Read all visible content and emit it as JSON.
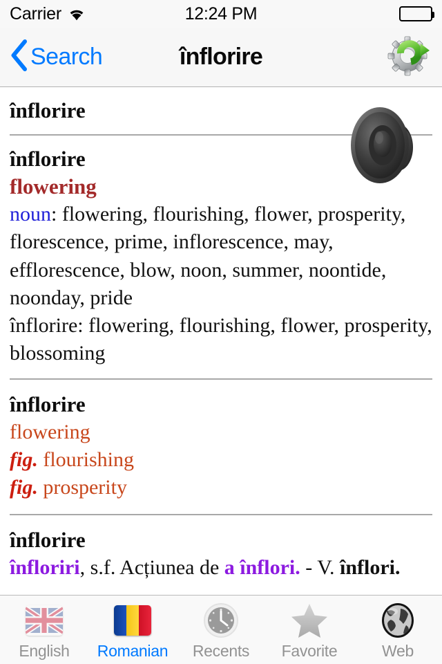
{
  "status_bar": {
    "carrier": "Carrier",
    "wifi_icon": "wifi-icon",
    "time": "12:24 PM",
    "battery_icon": "battery-full-icon"
  },
  "nav_bar": {
    "back_icon": "chevron-left-icon",
    "back_label": "Search",
    "title": "înflorire",
    "action_icon": "gear-refresh-icon"
  },
  "content": {
    "speaker_icon": "speaker-icon",
    "sections": [
      {
        "headword": "înflorire"
      },
      {
        "headword": "înflorire",
        "translation": "flowering",
        "pos_label": "noun",
        "pos_separator": ":",
        "synonyms": " flowering, flourishing, flower, prosperity, florescence, prime, inflorescence, may, efflorescence, blow, noon, summer, noontide, noonday, pride",
        "secondary_line": "înflorire: flowering, flourishing, flower, prosperity, blossoming"
      },
      {
        "headword": "înflorire",
        "senses": [
          {
            "marker": "",
            "text": "flowering"
          },
          {
            "marker": "fig.",
            "text": " flourishing"
          },
          {
            "marker": "fig.",
            "text": " prosperity"
          }
        ]
      },
      {
        "headword": "înflorire",
        "definition_parts": [
          {
            "text": "înfloriri",
            "style": "purple"
          },
          {
            "text": ", s.f. Acțiunea de ",
            "style": "plain"
          },
          {
            "text": "a înflori.",
            "style": "purple"
          },
          {
            "text": " - V. ",
            "style": "plain"
          },
          {
            "text": "înflori.",
            "style": "bold"
          }
        ]
      }
    ]
  },
  "tab_bar": {
    "tabs": [
      {
        "label": "English",
        "icon": "uk-flag-icon",
        "active": false
      },
      {
        "label": "Romanian",
        "icon": "romania-flag-icon",
        "active": true
      },
      {
        "label": "Recents",
        "icon": "clock-icon",
        "active": false
      },
      {
        "label": "Favorite",
        "icon": "star-icon",
        "active": false
      },
      {
        "label": "Web",
        "icon": "globe-icon",
        "active": false
      }
    ]
  },
  "colors": {
    "accent_blue": "#007aff",
    "translation_red": "#a32a2a",
    "sense_orange": "#c8471c",
    "fig_red": "#cc1f10",
    "purple": "#8c1ae0",
    "pos_blue": "#1f1fd8"
  }
}
